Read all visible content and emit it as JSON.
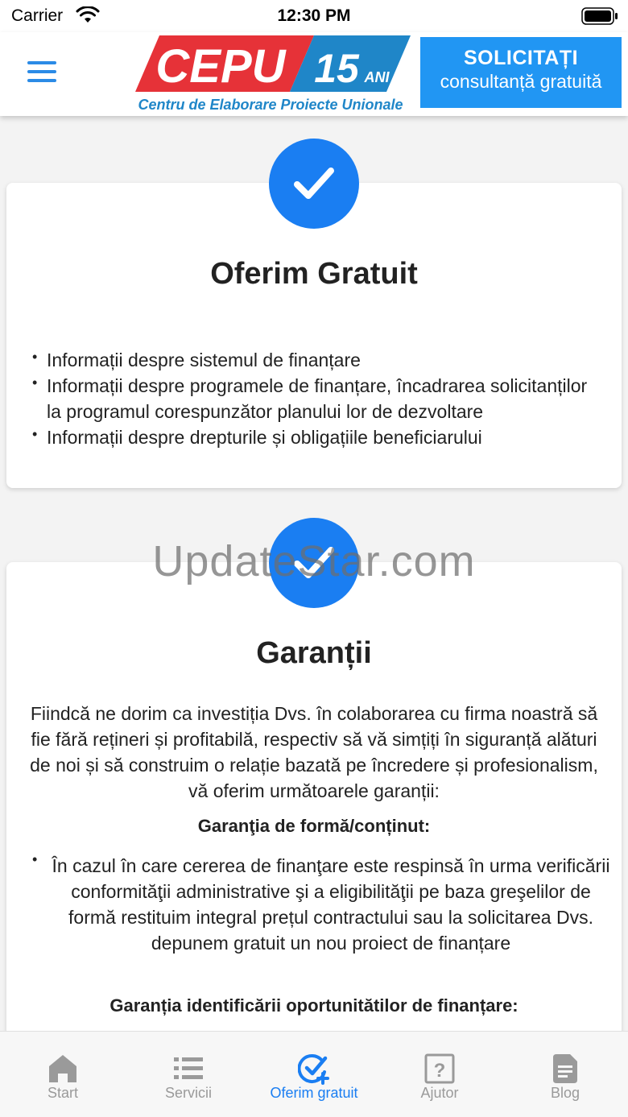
{
  "status_bar": {
    "carrier": "Carrier",
    "time": "12:30 PM"
  },
  "header": {
    "logo": {
      "brand": "CEPU",
      "anniversary_number": "15",
      "anniversary_word": "ANI",
      "tagline": "Centru de Elaborare Proiecte Unionale"
    },
    "cta": {
      "line1": "SOLICITAȚI",
      "line2": "consultanță gratuită"
    }
  },
  "card_offer": {
    "title": "Oferim Gratuit",
    "bullets": [
      "Informații despre sistemul de finanțare",
      "Informații despre programele de finanțare, încadrarea solicitanților la programul corespunzător planului lor de dezvoltare",
      "Informații despre drepturile și obligațiile beneficiarului"
    ]
  },
  "card_guarantees": {
    "title": "Garanții",
    "intro": "Fiindcă ne dorim ca investiția Dvs. în colaborarea cu firma noastră să fie fără rețineri și profitabilă, respectiv să vă simțiți în siguranță alături de noi și să construim o relație bazată pe încredere și profesionalism, vă oferim următoarele garanții:",
    "heading_form": "Garanţia de formă/conținut:",
    "item_form": "În cazul în care cererea de finanţare este respinsă în urma verificării conformităţii administrative şi a eligibilităţii pe baza greşelilor de formă restituim integral prețul contractului sau la solicitarea Dvs. depunem gratuit un nou proiect de finanțare",
    "heading_opportunities": "Garanția identificării oportunitătilor de finanțare:"
  },
  "watermark": "UpdateStar.com",
  "tabs": [
    {
      "label": "Start",
      "icon": "home-icon",
      "active": false
    },
    {
      "label": "Servicii",
      "icon": "list-icon",
      "active": false
    },
    {
      "label": "Oferim gratuit",
      "icon": "check-plus-icon",
      "active": true
    },
    {
      "label": "Ajutor",
      "icon": "help-icon",
      "active": false
    },
    {
      "label": "Blog",
      "icon": "document-icon",
      "active": false
    }
  ],
  "colors": {
    "accent": "#1a7ef2",
    "cta_background": "#2196f3",
    "logo_red": "#e63238",
    "logo_blue": "#1f86c8",
    "tab_inactive": "#9a9a9a"
  }
}
